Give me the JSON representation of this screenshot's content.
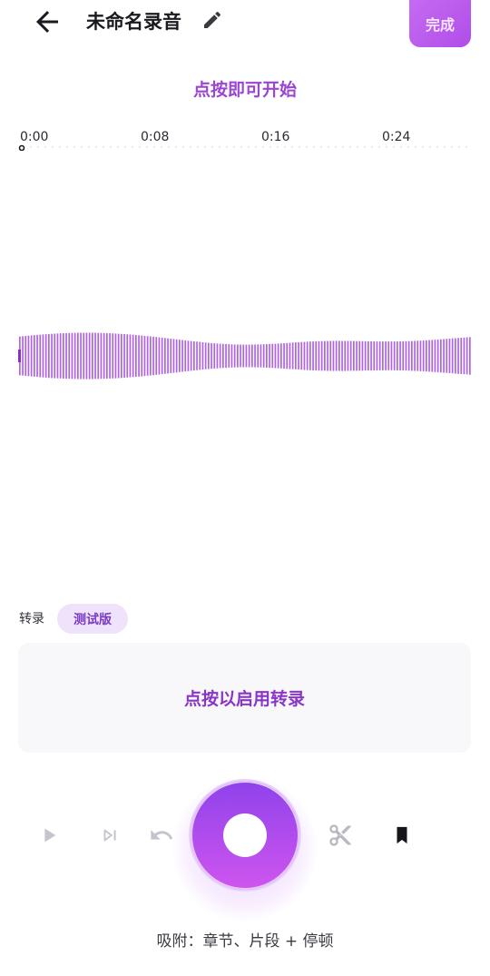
{
  "header": {
    "title": "未命名录音",
    "done_label": "完成",
    "icons": {
      "back": "arrow-left-icon",
      "edit": "pencil-icon"
    }
  },
  "hint": "点按即可开始",
  "timeline": {
    "labels": [
      "0:00",
      "0:08",
      "0:16",
      "0:24"
    ]
  },
  "transcription": {
    "label": "转录",
    "badge": "测试版",
    "prompt": "点按以启用转录"
  },
  "controls": {
    "icons": [
      "play-icon",
      "skip-next-icon",
      "undo-icon",
      "scissors-icon",
      "bookmark-icon"
    ]
  },
  "snap_text": "吸附：章节、片段 + 停顿",
  "colors": {
    "accent": "#9b45d4",
    "waveform": "#b065e0",
    "record_top": "#8e42ec",
    "record_bottom": "#cf55ef",
    "badge_bg": "#efe3fb"
  }
}
